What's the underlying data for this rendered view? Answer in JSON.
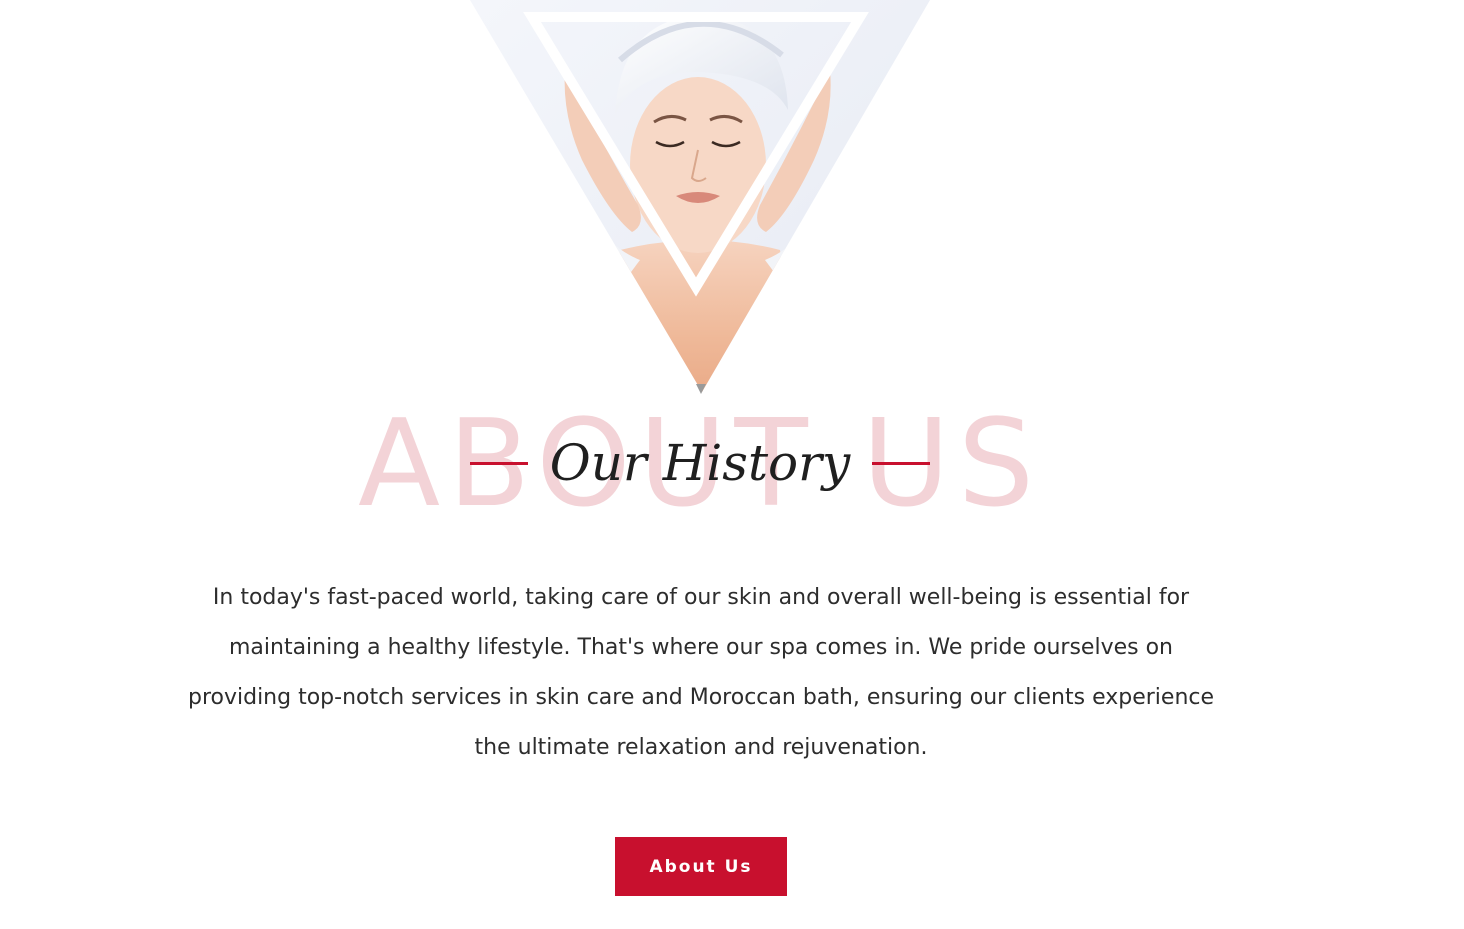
{
  "hero": {
    "image_alt": "Woman with towel wrapped on head receiving a facial massage"
  },
  "heading": {
    "watermark": "ABOUT US",
    "title": "Our History"
  },
  "intro": {
    "text": "In today's fast-paced world, taking care of our skin and overall well-being is essential for maintaining a healthy lifestyle. That's where our spa comes in. We pride ourselves on providing top-notch services in skin care and Moroccan bath, ensuring our clients experience the ultimate relaxation and rejuvenation."
  },
  "cta": {
    "label": "About Us"
  },
  "colors": {
    "accent": "#c8102e",
    "watermark": "#f3d3d7",
    "text": "#2d2d2d",
    "background": "#ffffff"
  }
}
